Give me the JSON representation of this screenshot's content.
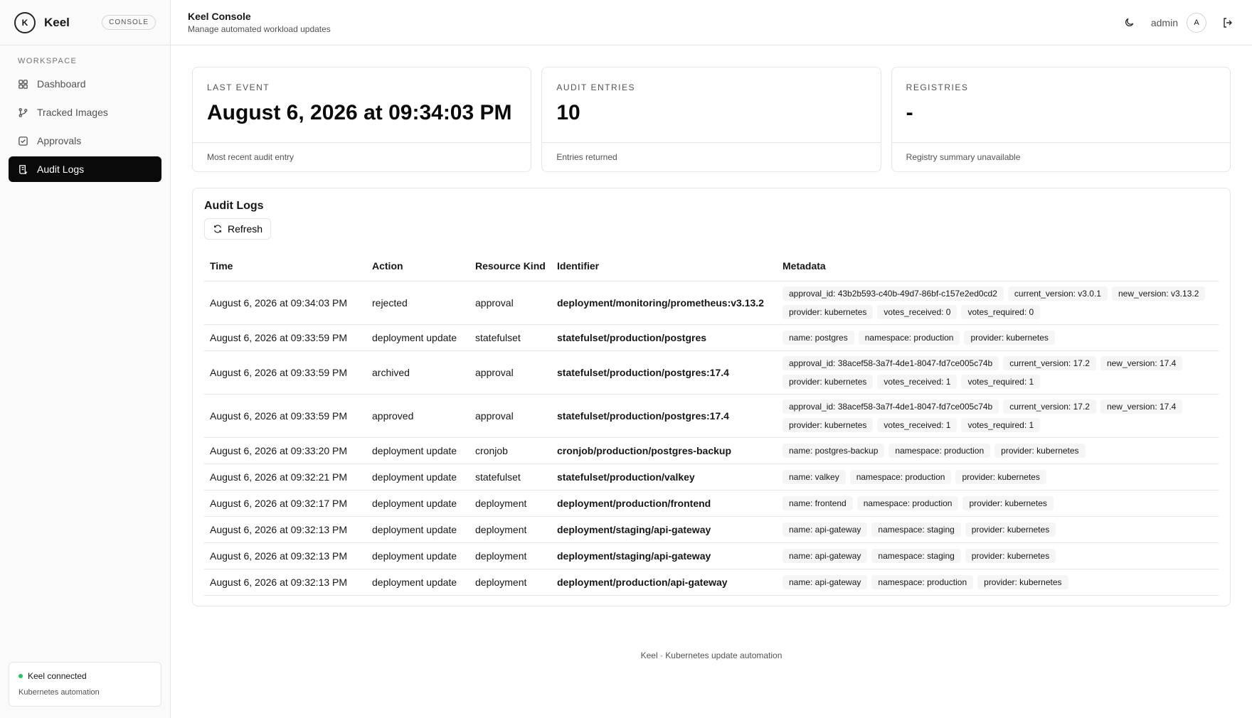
{
  "brand": {
    "name": "Keel",
    "badge": "CONSOLE"
  },
  "sidebar": {
    "section_label": "WORKSPACE",
    "items": [
      {
        "label": "Dashboard",
        "icon": "dashboard-icon",
        "active": false
      },
      {
        "label": "Tracked Images",
        "icon": "git-branch-icon",
        "active": false
      },
      {
        "label": "Approvals",
        "icon": "check-square-icon",
        "active": false
      },
      {
        "label": "Audit Logs",
        "icon": "scroll-icon",
        "active": true
      }
    ],
    "status": {
      "title": "Keel connected",
      "subtitle": "Kubernetes automation",
      "dot_color": "#22c55e"
    }
  },
  "header": {
    "title": "Keel Console",
    "subtitle": "Manage automated workload updates",
    "user": "admin",
    "avatar": "A"
  },
  "stats": [
    {
      "label": "LAST EVENT",
      "value": "August 6, 2026 at 09:34:03 PM",
      "foot": "Most recent audit entry"
    },
    {
      "label": "AUDIT ENTRIES",
      "value": "10",
      "foot": "Entries returned"
    },
    {
      "label": "REGISTRIES",
      "value": "-",
      "foot": "Registry summary unavailable"
    }
  ],
  "logs": {
    "title": "Audit Logs",
    "refresh_label": "Refresh",
    "columns": [
      "Time",
      "Action",
      "Resource Kind",
      "Identifier",
      "Metadata"
    ],
    "rows": [
      {
        "time": "August 6, 2026 at 09:34:03 PM",
        "action": "rejected",
        "kind": "approval",
        "identifier": "deployment/monitoring/prometheus:v3.13.2",
        "metadata": [
          "approval_id: 43b2b593-c40b-49d7-86bf-c157e2ed0cd2",
          "current_version: v3.0.1",
          "new_version: v3.13.2",
          "provider: kubernetes",
          "votes_received: 0",
          "votes_required: 0"
        ]
      },
      {
        "time": "August 6, 2026 at 09:33:59 PM",
        "action": "deployment update",
        "kind": "statefulset",
        "identifier": "statefulset/production/postgres",
        "metadata": [
          "name: postgres",
          "namespace: production",
          "provider: kubernetes"
        ]
      },
      {
        "time": "August 6, 2026 at 09:33:59 PM",
        "action": "archived",
        "kind": "approval",
        "identifier": "statefulset/production/postgres:17.4",
        "metadata": [
          "approval_id: 38acef58-3a7f-4de1-8047-fd7ce005c74b",
          "current_version: 17.2",
          "new_version: 17.4",
          "provider: kubernetes",
          "votes_received: 1",
          "votes_required: 1"
        ]
      },
      {
        "time": "August 6, 2026 at 09:33:59 PM",
        "action": "approved",
        "kind": "approval",
        "identifier": "statefulset/production/postgres:17.4",
        "metadata": [
          "approval_id: 38acef58-3a7f-4de1-8047-fd7ce005c74b",
          "current_version: 17.2",
          "new_version: 17.4",
          "provider: kubernetes",
          "votes_received: 1",
          "votes_required: 1"
        ]
      },
      {
        "time": "August 6, 2026 at 09:33:20 PM",
        "action": "deployment update",
        "kind": "cronjob",
        "identifier": "cronjob/production/postgres-backup",
        "metadata": [
          "name: postgres-backup",
          "namespace: production",
          "provider: kubernetes"
        ]
      },
      {
        "time": "August 6, 2026 at 09:32:21 PM",
        "action": "deployment update",
        "kind": "statefulset",
        "identifier": "statefulset/production/valkey",
        "metadata": [
          "name: valkey",
          "namespace: production",
          "provider: kubernetes"
        ]
      },
      {
        "time": "August 6, 2026 at 09:32:17 PM",
        "action": "deployment update",
        "kind": "deployment",
        "identifier": "deployment/production/frontend",
        "metadata": [
          "name: frontend",
          "namespace: production",
          "provider: kubernetes"
        ]
      },
      {
        "time": "August 6, 2026 at 09:32:13 PM",
        "action": "deployment update",
        "kind": "deployment",
        "identifier": "deployment/staging/api-gateway",
        "metadata": [
          "name: api-gateway",
          "namespace: staging",
          "provider: kubernetes"
        ]
      },
      {
        "time": "August 6, 2026 at 09:32:13 PM",
        "action": "deployment update",
        "kind": "deployment",
        "identifier": "deployment/staging/api-gateway",
        "metadata": [
          "name: api-gateway",
          "namespace: staging",
          "provider: kubernetes"
        ]
      },
      {
        "time": "August 6, 2026 at 09:32:13 PM",
        "action": "deployment update",
        "kind": "deployment",
        "identifier": "deployment/production/api-gateway",
        "metadata": [
          "name: api-gateway",
          "namespace: production",
          "provider: kubernetes"
        ]
      }
    ]
  },
  "footer": {
    "text": "Keel · Kubernetes update automation"
  }
}
